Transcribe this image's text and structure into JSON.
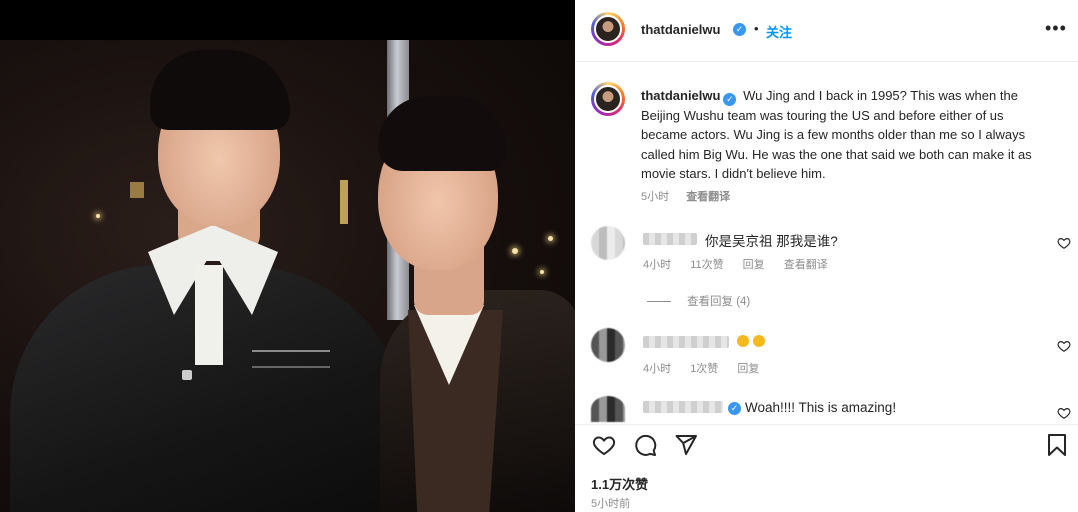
{
  "post": {
    "username": "thatdanielwu",
    "verified_mark": "✓",
    "follow_label": "关注",
    "separator": "•",
    "more_label": "•••",
    "caption": "Wu Jing and I back in 1995? This was when the Beijing Wushu team was touring the US and before either of us became actors. Wu Jing is a few months older than me so I always called him Big Wu. He was the one that said we both can make it as movie stars. I didn't believe him.",
    "caption_time": "5小时",
    "translate_label": "查看翻译"
  },
  "comments": [
    {
      "text": "你是吴京祖 那我是谁?",
      "time": "4小时",
      "likes": "11次赞",
      "reply": "回复",
      "translate": "查看翻译"
    },
    {
      "time": "4小时",
      "likes": "1次赞",
      "reply": "回复"
    },
    {
      "text": "Woah!!!! This is amazing!"
    }
  ],
  "replies_label": "查看回复 (4)",
  "footer": {
    "likes": "1.1万次赞",
    "time": "5小时前"
  },
  "icons": {
    "like": "heart-icon",
    "comment": "comment-icon",
    "share": "send-icon",
    "save": "bookmark-icon"
  },
  "colors": {
    "link": "#0095f6",
    "verified": "#3897f0",
    "muted": "#8e8e8e"
  }
}
